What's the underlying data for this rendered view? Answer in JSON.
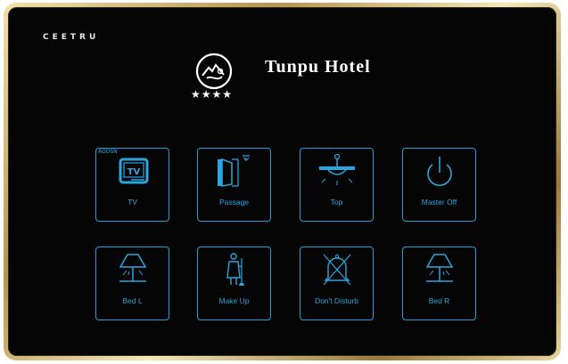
{
  "brand": "CEETRU",
  "hotel": {
    "name": "Tunpu Hotel",
    "stars": "★★★★"
  },
  "buttons": [
    {
      "label": "TV",
      "icon": "tv-icon",
      "badge": "AODSN",
      "tv_text": "TV"
    },
    {
      "label": "Passage",
      "icon": "door-light-icon"
    },
    {
      "label": "Top",
      "icon": "ceiling-light-icon"
    },
    {
      "label": "Master Off",
      "icon": "power-icon"
    },
    {
      "label": "Bed L",
      "icon": "table-lamp-icon"
    },
    {
      "label": "Make Up",
      "icon": "cleaning-maid-icon"
    },
    {
      "label": "Don't Disturb",
      "icon": "bell-crossed-icon"
    },
    {
      "label": "Bed R",
      "icon": "table-lamp-icon"
    }
  ],
  "colors": {
    "accent": "#1fa0d8",
    "panel": "#050505",
    "frame": "#c9a65a"
  }
}
